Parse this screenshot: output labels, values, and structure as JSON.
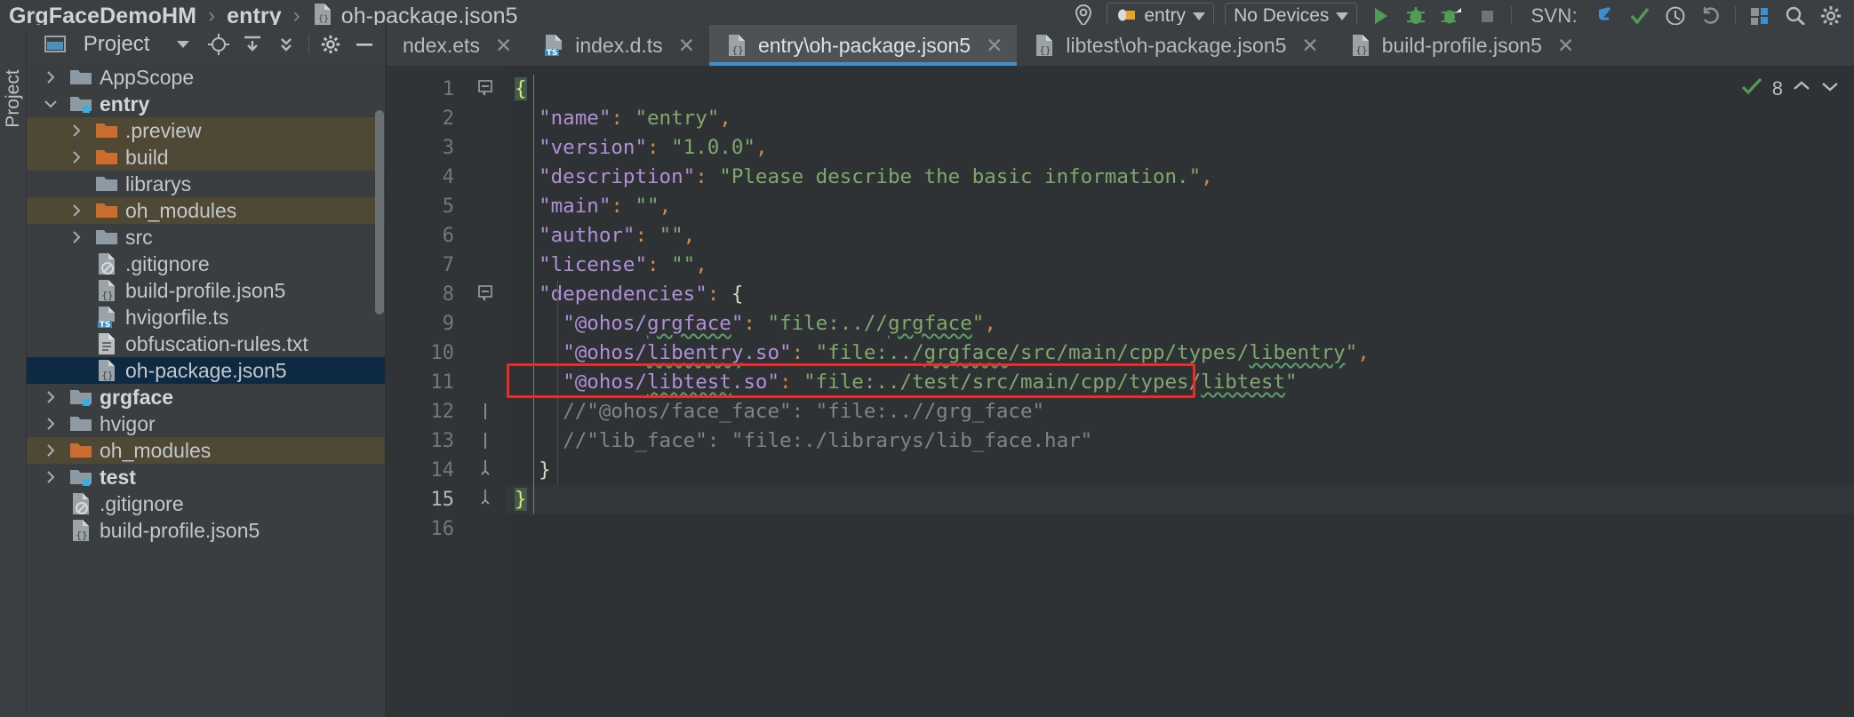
{
  "breadcrumb": {
    "items": [
      {
        "label": "GrgFaceDemoHM",
        "bold": true,
        "icon": ""
      },
      {
        "label": "entry",
        "bold": true,
        "icon": ""
      },
      {
        "label": "oh-package.json5",
        "bold": false,
        "icon": "json5-file-icon"
      }
    ],
    "separator": "›"
  },
  "toolbar": {
    "device_target": "entry",
    "device_list": "No Devices",
    "svn_label": "SVN:",
    "icons": [
      "search-everywhere-icon",
      "run-config-icon",
      "run-icon",
      "debug-icon",
      "profile-icon",
      "stop-icon",
      "svn-update-icon",
      "svn-commit-icon",
      "svn-history-icon",
      "svn-rollback-icon",
      "device-manager-icon",
      "search-icon",
      "settings-gear-icon"
    ]
  },
  "tool_window": {
    "vertical_tab": "Project"
  },
  "project_panel": {
    "title": "Project",
    "header_icons": [
      "chevron-down-icon",
      "locate-icon",
      "collapse-expand-icon",
      "collapse-all-icon",
      "gear-icon",
      "minimize-icon"
    ],
    "tree": [
      {
        "label": "AppScope",
        "indent": 1,
        "arrow": "collapsed",
        "icon": "folder-icon",
        "state": "normal",
        "bold": false
      },
      {
        "label": "entry",
        "indent": 1,
        "arrow": "expanded",
        "icon": "module-folder-icon",
        "state": "normal",
        "bold": true
      },
      {
        "label": ".preview",
        "indent": 2,
        "arrow": "collapsed",
        "icon": "excluded-folder-icon",
        "state": "excluded",
        "bold": false
      },
      {
        "label": "build",
        "indent": 2,
        "arrow": "collapsed",
        "icon": "excluded-folder-icon",
        "state": "excluded",
        "bold": false
      },
      {
        "label": "librarys",
        "indent": 2,
        "arrow": "none",
        "icon": "folder-icon",
        "state": "normal",
        "bold": false
      },
      {
        "label": "oh_modules",
        "indent": 2,
        "arrow": "collapsed",
        "icon": "excluded-folder-icon",
        "state": "excluded",
        "bold": false
      },
      {
        "label": "src",
        "indent": 2,
        "arrow": "collapsed",
        "icon": "folder-icon",
        "state": "normal",
        "bold": false
      },
      {
        "label": ".gitignore",
        "indent": 2,
        "arrow": "none",
        "icon": "gitignore-file-icon",
        "state": "normal",
        "bold": false
      },
      {
        "label": "build-profile.json5",
        "indent": 2,
        "arrow": "none",
        "icon": "json5-file-icon",
        "state": "normal",
        "bold": false
      },
      {
        "label": "hvigorfile.ts",
        "indent": 2,
        "arrow": "none",
        "icon": "ts-file-icon",
        "state": "normal",
        "bold": false
      },
      {
        "label": "obfuscation-rules.txt",
        "indent": 2,
        "arrow": "none",
        "icon": "txt-file-icon",
        "state": "normal",
        "bold": false
      },
      {
        "label": "oh-package.json5",
        "indent": 2,
        "arrow": "none",
        "icon": "json5-file-icon",
        "state": "selected",
        "bold": false
      },
      {
        "label": "grgface",
        "indent": 1,
        "arrow": "collapsed",
        "icon": "module-folder-icon",
        "state": "normal",
        "bold": true
      },
      {
        "label": "hvigor",
        "indent": 1,
        "arrow": "collapsed",
        "icon": "folder-icon",
        "state": "normal",
        "bold": false
      },
      {
        "label": "oh_modules",
        "indent": 1,
        "arrow": "collapsed",
        "icon": "excluded-folder-icon",
        "state": "excluded",
        "bold": false
      },
      {
        "label": "test",
        "indent": 1,
        "arrow": "collapsed",
        "icon": "module-folder-icon",
        "state": "normal",
        "bold": true
      },
      {
        "label": ".gitignore",
        "indent": 1,
        "arrow": "none",
        "icon": "gitignore-file-icon",
        "state": "normal",
        "bold": false
      },
      {
        "label": "build-profile.json5",
        "indent": 1,
        "arrow": "none",
        "icon": "json5-file-icon",
        "state": "normal",
        "bold": false
      }
    ]
  },
  "editor_tabs": [
    {
      "label": "ndex.ets",
      "icon": "ets-file-icon",
      "active": false,
      "close": "✕"
    },
    {
      "label": "index.d.ts",
      "icon": "ts-file-icon",
      "active": false,
      "close": "✕"
    },
    {
      "label": "entry\\oh-package.json5",
      "icon": "json5-file-icon",
      "active": true,
      "close": "✕"
    },
    {
      "label": "libtest\\oh-package.json5",
      "icon": "json5-file-icon",
      "active": false,
      "close": "✕"
    },
    {
      "label": "build-profile.json5",
      "icon": "json5-file-icon",
      "active": false,
      "close": "✕"
    }
  ],
  "inspection": {
    "count": "8",
    "check_icon": "inspection-ok-icon",
    "up_icon": "chevron-up-icon",
    "down_icon": "chevron-down-icon"
  },
  "code": {
    "filename": "entry\\oh-package.json5",
    "lines": [
      {
        "n": "1",
        "indent": 0,
        "fold": "minus",
        "tokens": [
          {
            "t": "{",
            "c": "by brace-hl"
          }
        ]
      },
      {
        "n": "2",
        "indent": 1,
        "fold": "",
        "tokens": [
          {
            "t": "\"name\"",
            "c": "k"
          },
          {
            "t": ":",
            "c": "p"
          },
          {
            "t": " ",
            "c": ""
          },
          {
            "t": "\"entry\"",
            "c": "s"
          },
          {
            "t": ",",
            "c": "p"
          }
        ]
      },
      {
        "n": "3",
        "indent": 1,
        "fold": "",
        "tokens": [
          {
            "t": "\"version\"",
            "c": "k"
          },
          {
            "t": ":",
            "c": "p"
          },
          {
            "t": " ",
            "c": ""
          },
          {
            "t": "\"1.0.0\"",
            "c": "s"
          },
          {
            "t": ",",
            "c": "p"
          }
        ]
      },
      {
        "n": "4",
        "indent": 1,
        "fold": "",
        "tokens": [
          {
            "t": "\"description\"",
            "c": "k"
          },
          {
            "t": ":",
            "c": "p"
          },
          {
            "t": " ",
            "c": ""
          },
          {
            "t": "\"Please describe the basic information.\"",
            "c": "s"
          },
          {
            "t": ",",
            "c": "p"
          }
        ]
      },
      {
        "n": "5",
        "indent": 1,
        "fold": "",
        "tokens": [
          {
            "t": "\"main\"",
            "c": "k"
          },
          {
            "t": ":",
            "c": "p"
          },
          {
            "t": " ",
            "c": ""
          },
          {
            "t": "\"\"",
            "c": "s"
          },
          {
            "t": ",",
            "c": "p"
          }
        ]
      },
      {
        "n": "6",
        "indent": 1,
        "fold": "",
        "tokens": [
          {
            "t": "\"author\"",
            "c": "k"
          },
          {
            "t": ":",
            "c": "p"
          },
          {
            "t": " ",
            "c": ""
          },
          {
            "t": "\"\"",
            "c": "s"
          },
          {
            "t": ",",
            "c": "p"
          }
        ]
      },
      {
        "n": "7",
        "indent": 1,
        "fold": "",
        "tokens": [
          {
            "t": "\"license\"",
            "c": "k"
          },
          {
            "t": ":",
            "c": "p"
          },
          {
            "t": " ",
            "c": ""
          },
          {
            "t": "\"\"",
            "c": "s"
          },
          {
            "t": ",",
            "c": "p"
          }
        ]
      },
      {
        "n": "8",
        "indent": 1,
        "fold": "minus",
        "tokens": [
          {
            "t": "\"dependencies\"",
            "c": "k"
          },
          {
            "t": ":",
            "c": "p"
          },
          {
            "t": " ",
            "c": ""
          },
          {
            "t": "{",
            "c": "b"
          }
        ]
      },
      {
        "n": "9",
        "indent": 2,
        "fold": "",
        "tokens": [
          {
            "t": "\"@ohos/",
            "c": "k"
          },
          {
            "t": "grgface",
            "c": "k wavy"
          },
          {
            "t": "\"",
            "c": "k"
          },
          {
            "t": ":",
            "c": "p"
          },
          {
            "t": " ",
            "c": ""
          },
          {
            "t": "\"file:..//",
            "c": "s"
          },
          {
            "t": "grgface",
            "c": "s wavy"
          },
          {
            "t": "\"",
            "c": "s"
          },
          {
            "t": ",",
            "c": "p"
          }
        ]
      },
      {
        "n": "10",
        "indent": 2,
        "fold": "",
        "tokens": [
          {
            "t": "\"@ohos/",
            "c": "k"
          },
          {
            "t": "libentry",
            "c": "k wavy"
          },
          {
            "t": ".so\"",
            "c": "k"
          },
          {
            "t": ":",
            "c": "p"
          },
          {
            "t": " ",
            "c": ""
          },
          {
            "t": "\"file:../",
            "c": "s"
          },
          {
            "t": "grgface",
            "c": "s wavy"
          },
          {
            "t": "/src/main/cpp/types/",
            "c": "s"
          },
          {
            "t": "libentry",
            "c": "s wavy"
          },
          {
            "t": "\"",
            "c": "s"
          },
          {
            "t": ",",
            "c": "p"
          }
        ]
      },
      {
        "n": "11",
        "indent": 2,
        "fold": "",
        "tokens": [
          {
            "t": "\"@ohos/",
            "c": "k"
          },
          {
            "t": "libtest",
            "c": "k wavy"
          },
          {
            "t": ".so\"",
            "c": "k"
          },
          {
            "t": ":",
            "c": "p"
          },
          {
            "t": " ",
            "c": ""
          },
          {
            "t": "\"file:../test/src/main/cpp/types/",
            "c": "s"
          },
          {
            "t": "libtest",
            "c": "s wavy"
          },
          {
            "t": "\"",
            "c": "s"
          }
        ]
      },
      {
        "n": "12",
        "indent": 2,
        "fold": "plus",
        "tokens": [
          {
            "t": "//\"@ohos/face_face\": \"file:..//grg_face\"",
            "c": "cm"
          }
        ]
      },
      {
        "n": "13",
        "indent": 2,
        "fold": "plus",
        "tokens": [
          {
            "t": "//\"lib_face\": \"file:./librarys/lib_face.har\"",
            "c": "cm"
          }
        ]
      },
      {
        "n": "14",
        "indent": 1,
        "fold": "end",
        "tokens": [
          {
            "t": "}",
            "c": "b"
          }
        ]
      },
      {
        "n": "15",
        "indent": 0,
        "fold": "end",
        "tokens": [
          {
            "t": "}",
            "c": "by brace-hl"
          }
        ]
      },
      {
        "n": "16",
        "indent": 0,
        "fold": "",
        "tokens": []
      }
    ],
    "current_line": "15",
    "annotation": {
      "type": "red-rectangle",
      "target_line": "11"
    }
  },
  "colors": {
    "accent_blue": "#3d8fd1",
    "annotation_red": "#ee2b26",
    "excluded_row": "#4e4835",
    "selected_row": "#0d2a42",
    "string_green": "#7ea96a",
    "key_purple": "#b08fd8",
    "punct_orange": "#d48b3f",
    "comment_gray": "#7f8487",
    "folder_orange": "#cc6d2e",
    "folder_gray": "#8d9aa3",
    "module_marker": "#35b0e0"
  }
}
